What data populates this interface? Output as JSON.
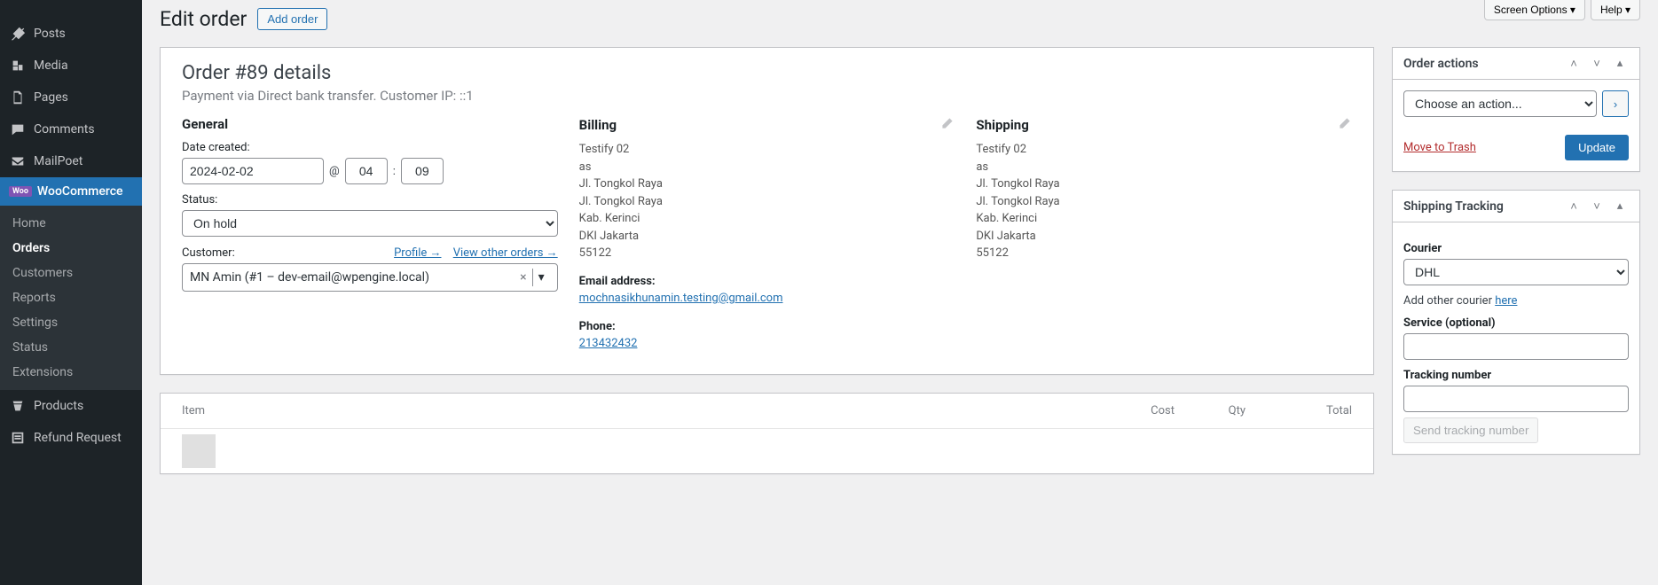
{
  "top_tabs": {
    "screen_options": "Screen Options",
    "help": "Help"
  },
  "sidebar": {
    "items": [
      {
        "label": "Posts"
      },
      {
        "label": "Media"
      },
      {
        "label": "Pages"
      },
      {
        "label": "Comments"
      },
      {
        "label": "MailPoet"
      },
      {
        "label": "WooCommerce"
      },
      {
        "label": "Products"
      },
      {
        "label": "Refund Request"
      }
    ],
    "woo_submenu": [
      {
        "label": "Home"
      },
      {
        "label": "Orders"
      },
      {
        "label": "Customers"
      },
      {
        "label": "Reports"
      },
      {
        "label": "Settings"
      },
      {
        "label": "Status"
      },
      {
        "label": "Extensions"
      }
    ]
  },
  "page": {
    "title": "Edit order",
    "add_button": "Add order"
  },
  "order": {
    "heading": "Order #89 details",
    "subheading": "Payment via Direct bank transfer. Customer IP: ::1",
    "general": {
      "title": "General",
      "date_label": "Date created:",
      "date": "2024-02-02",
      "at": "@",
      "hour": "04",
      "minute": "09",
      "status_label": "Status:",
      "status": "On hold",
      "customer_label": "Customer:",
      "profile_link": "Profile →",
      "view_orders_link": "View other orders →",
      "customer_value": "MN Amin (#1 – dev-email@wpengine.local)"
    },
    "billing": {
      "title": "Billing",
      "name": "Testify 02",
      "line2": "as",
      "addr1": "Jl. Tongkol Raya",
      "addr2": "Jl. Tongkol Raya",
      "city": "Kab. Kerinci",
      "state": "DKI Jakarta",
      "zip": "55122",
      "email_label": "Email address:",
      "email": "mochnasikhunamin.testing@gmail.com",
      "phone_label": "Phone:",
      "phone": "213432432"
    },
    "shipping": {
      "title": "Shipping",
      "name": "Testify 02",
      "line2": "as",
      "addr1": "Jl. Tongkol Raya",
      "addr2": "Jl. Tongkol Raya",
      "city": "Kab. Kerinci",
      "state": "DKI Jakarta",
      "zip": "55122"
    }
  },
  "items": {
    "col_item": "Item",
    "col_cost": "Cost",
    "col_qty": "Qty",
    "col_total": "Total"
  },
  "actions_panel": {
    "title": "Order actions",
    "placeholder": "Choose an action...",
    "trash": "Move to Trash",
    "update": "Update"
  },
  "tracking_panel": {
    "title": "Shipping Tracking",
    "courier_label": "Courier",
    "courier_value": "DHL",
    "add_other_prefix": "Add other courier ",
    "add_other_link": "here",
    "service_label": "Service (optional)",
    "tn_label": "Tracking number",
    "send_btn": "Send tracking number"
  }
}
